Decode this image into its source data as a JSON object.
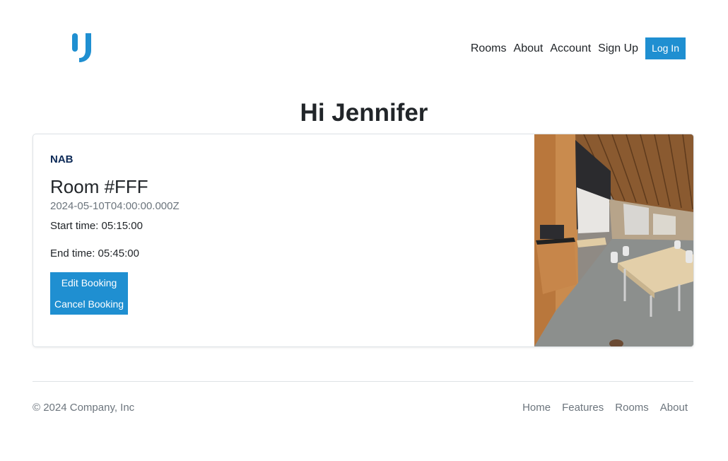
{
  "header": {
    "logo_icon": "brand-u-logo",
    "brand_color": "#1f8fd1",
    "nav": [
      {
        "label": "Rooms"
      },
      {
        "label": "About"
      },
      {
        "label": "Account"
      },
      {
        "label": "Sign Up"
      }
    ],
    "login_label": "Log In"
  },
  "greeting": "Hi Jennifer",
  "booking": {
    "building": "NAB",
    "room": "Room #FFF",
    "date": "2024-05-10T04:00:00.000Z",
    "start_time": "Start time: 05:15:00",
    "end_time": "End time: 05:45:00",
    "edit_label": "Edit Booking",
    "cancel_label": "Cancel Booking",
    "image_alt": "classroom photo"
  },
  "footer": {
    "copyright": "© 2024 Company, Inc",
    "links": [
      {
        "label": "Home"
      },
      {
        "label": "Features"
      },
      {
        "label": "Rooms"
      },
      {
        "label": "About"
      }
    ]
  }
}
